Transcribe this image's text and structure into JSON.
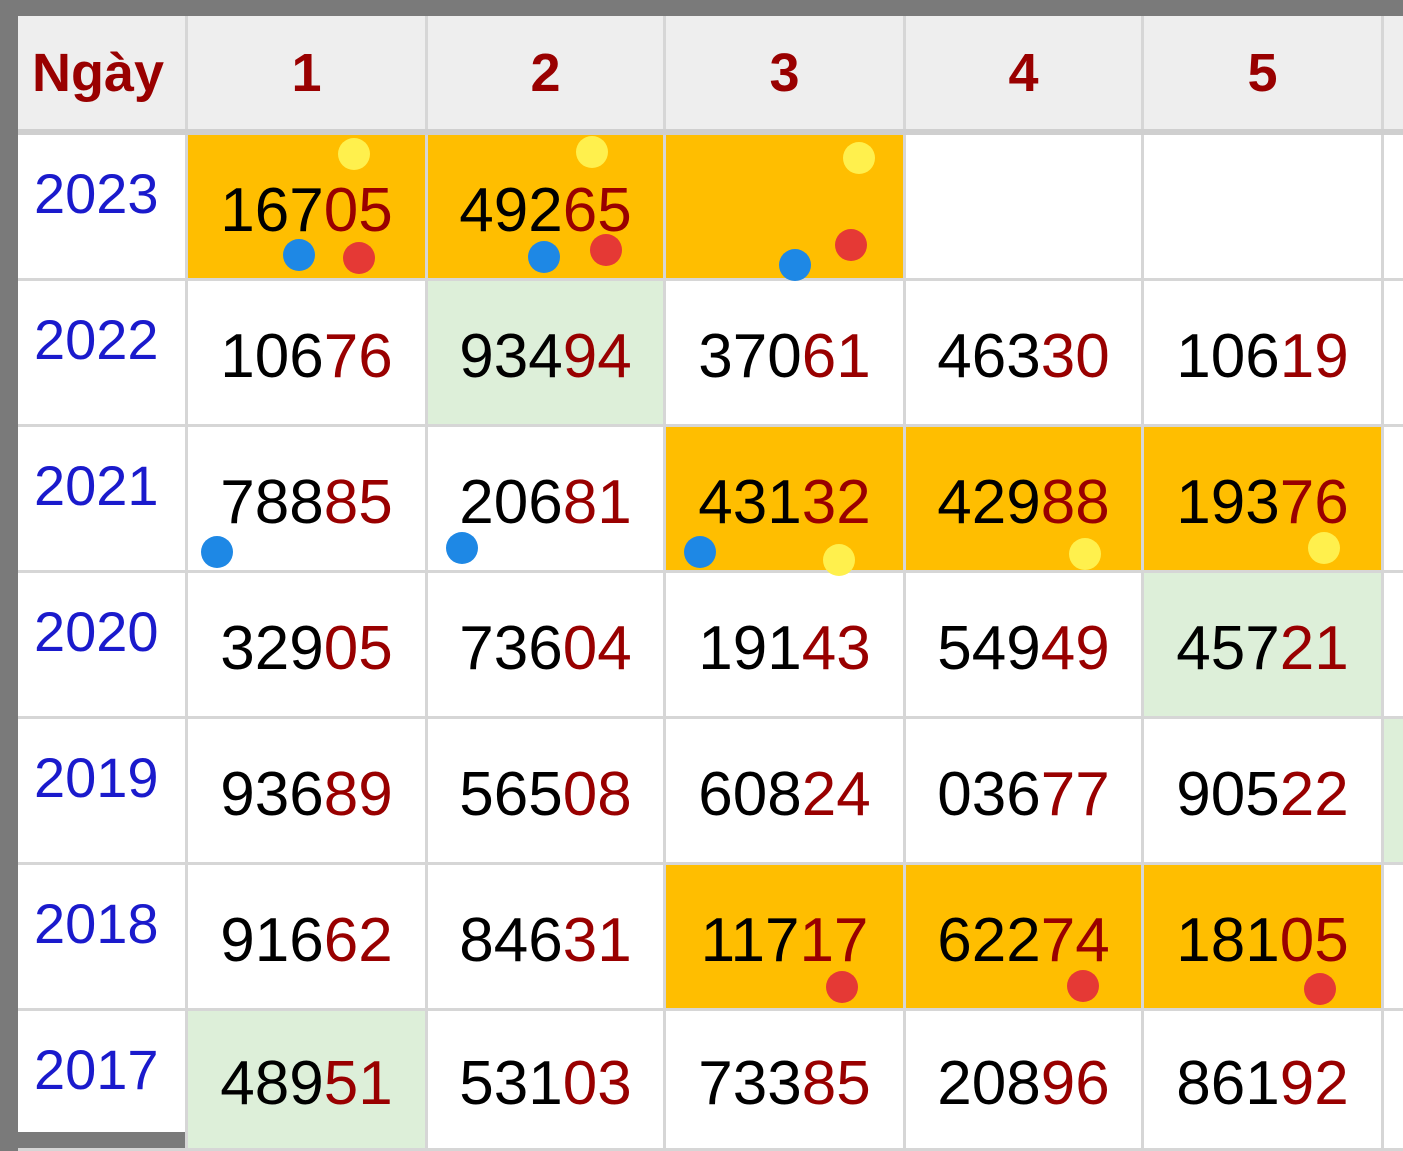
{
  "header": {
    "day_label": "Ngày",
    "columns": [
      "1",
      "2",
      "3",
      "4",
      "5"
    ]
  },
  "rows": [
    {
      "year": "2023",
      "cells": [
        {
          "head": "167",
          "tail": "05",
          "bg": "orange"
        },
        {
          "head": "492",
          "tail": "65",
          "bg": "orange"
        },
        {
          "head": "",
          "tail": "",
          "bg": "orange"
        },
        {
          "head": "",
          "tail": "",
          "bg": "white"
        },
        {
          "head": "",
          "tail": "",
          "bg": "white"
        }
      ]
    },
    {
      "year": "2022",
      "cells": [
        {
          "head": "106",
          "tail": "76",
          "bg": "white"
        },
        {
          "head": "934",
          "tail": "94",
          "bg": "green"
        },
        {
          "head": "370",
          "tail": "61",
          "bg": "white"
        },
        {
          "head": "463",
          "tail": "30",
          "bg": "white"
        },
        {
          "head": "106",
          "tail": "19",
          "bg": "white"
        }
      ]
    },
    {
      "year": "2021",
      "cells": [
        {
          "head": "788",
          "tail": "85",
          "bg": "white"
        },
        {
          "head": "206",
          "tail": "81",
          "bg": "white"
        },
        {
          "head": "431",
          "tail": "32",
          "bg": "orange"
        },
        {
          "head": "429",
          "tail": "88",
          "bg": "orange"
        },
        {
          "head": "193",
          "tail": "76",
          "bg": "orange"
        }
      ]
    },
    {
      "year": "2020",
      "cells": [
        {
          "head": "329",
          "tail": "05",
          "bg": "white"
        },
        {
          "head": "736",
          "tail": "04",
          "bg": "white"
        },
        {
          "head": "191",
          "tail": "43",
          "bg": "white"
        },
        {
          "head": "549",
          "tail": "49",
          "bg": "white"
        },
        {
          "head": "457",
          "tail": "21",
          "bg": "green"
        }
      ]
    },
    {
      "year": "2019",
      "cells": [
        {
          "head": "936",
          "tail": "89",
          "bg": "white"
        },
        {
          "head": "565",
          "tail": "08",
          "bg": "white"
        },
        {
          "head": "608",
          "tail": "24",
          "bg": "white"
        },
        {
          "head": "036",
          "tail": "77",
          "bg": "white"
        },
        {
          "head": "905",
          "tail": "22",
          "bg": "white"
        }
      ]
    },
    {
      "year": "2018",
      "cells": [
        {
          "head": "916",
          "tail": "62",
          "bg": "white"
        },
        {
          "head": "846",
          "tail": "31",
          "bg": "white"
        },
        {
          "head": "117",
          "tail": "17",
          "bg": "orange"
        },
        {
          "head": "622",
          "tail": "74",
          "bg": "orange"
        },
        {
          "head": "181",
          "tail": "05",
          "bg": "orange"
        }
      ]
    },
    {
      "year": "2017",
      "cells": [
        {
          "head": "489",
          "tail": "51",
          "bg": "green"
        },
        {
          "head": "531",
          "tail": "03",
          "bg": "white"
        },
        {
          "head": "733",
          "tail": "85",
          "bg": "white"
        },
        {
          "head": "208",
          "tail": "96",
          "bg": "white"
        },
        {
          "head": "861",
          "tail": "92",
          "bg": "white"
        }
      ]
    }
  ],
  "colors": {
    "orange": "#ffbe00",
    "green": "#ddefd9",
    "white": "#ffffff",
    "header_text": "#990000",
    "year_text": "#1a1acc",
    "dot_blue": "#1e88e5",
    "dot_red": "#e53935",
    "dot_yellow": "#fff04d"
  }
}
